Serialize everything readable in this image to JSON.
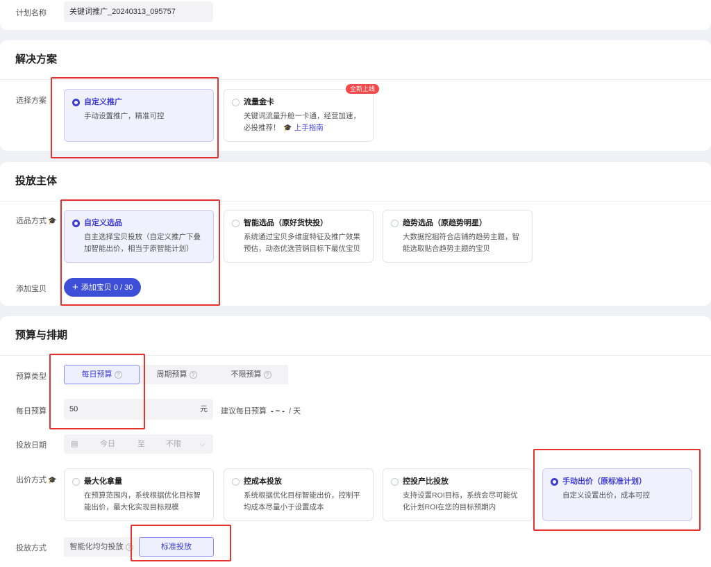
{
  "plan": {
    "label": "计划名称",
    "value": "关键词推广_20240313_095757"
  },
  "solution": {
    "title": "解决方案",
    "row_label": "选择方案",
    "options": [
      {
        "title": "自定义推广",
        "desc": "手动设置推广，精准可控",
        "selected": true
      },
      {
        "title": "流量金卡",
        "desc": "关键词流量升舱一卡通，经营加速，必投推荐！",
        "guide": "上手指南",
        "badge": "全新上线",
        "selected": false
      }
    ]
  },
  "subject": {
    "title": "投放主体",
    "select_label": "选品方式",
    "options": [
      {
        "title": "自定义选品",
        "desc": "自主选择宝贝投放（自定义推广下叠加智能出价，相当于原智能计划）",
        "selected": true
      },
      {
        "title": "智能选品（原好货快投）",
        "desc": "系统通过宝贝多维度特征及推广效果预估，动态优选营销目标下最优宝贝",
        "selected": false
      },
      {
        "title": "趋势选品（原趋势明星）",
        "desc": "大数据挖掘符合店铺的趋势主题，智能选取贴合趋势主题的宝贝",
        "selected": false
      }
    ],
    "add_label": "添加宝贝",
    "add_button": "添加宝贝 0 / 30"
  },
  "budget": {
    "title": "预算与排期",
    "type_label": "预算类型",
    "types": [
      "每日预算",
      "周期预算",
      "不限预算"
    ],
    "daily_label": "每日预算",
    "daily_value": "50",
    "daily_unit": "元",
    "suggest_prefix": "建议每日预算",
    "suggest_value": "- ~ -",
    "suggest_suffix": "/ 天",
    "date_label": "投放日期",
    "date_start": "今日",
    "date_sep": "至",
    "date_end": "不限",
    "bid_label": "出价方式",
    "bids": [
      {
        "title": "最大化拿量",
        "desc": "在预算范围内，系统根据优化目标智能出价，最大化实现目标规模",
        "selected": false
      },
      {
        "title": "控成本投放",
        "desc": "系统根据优化目标智能出价，控制平均成本尽量小于设置成本",
        "selected": false
      },
      {
        "title": "控投产比投放",
        "desc": "支持设置ROI目标，系统会尽可能优化计划ROI在您的目标预期内",
        "selected": false
      },
      {
        "title": "手动出价（原标准计划）",
        "desc": "自定义设置出价，成本可控",
        "selected": true
      }
    ],
    "mode_label": "投放方式",
    "modes": [
      "智能化均匀投放",
      "标准投放"
    ]
  }
}
